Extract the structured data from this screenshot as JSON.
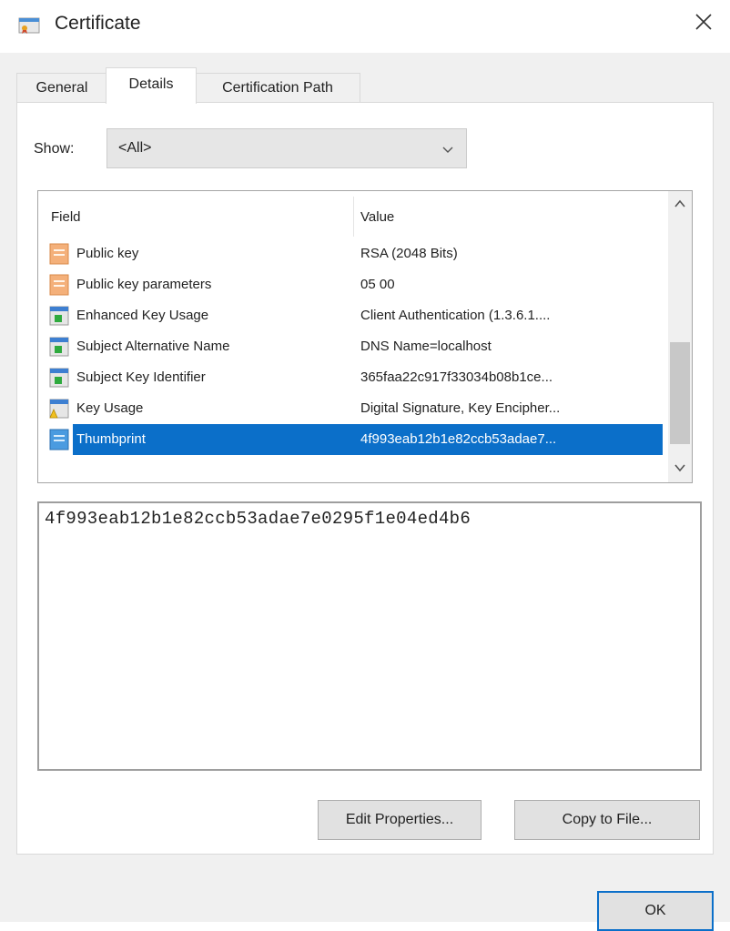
{
  "window": {
    "title": "Certificate",
    "close_label": "X"
  },
  "tabs": [
    {
      "label": "General",
      "active": false
    },
    {
      "label": "Details",
      "active": true
    },
    {
      "label": "Certification Path",
      "active": false
    }
  ],
  "show": {
    "label": "Show:",
    "selected": "<All>"
  },
  "fields": {
    "columns": [
      "Field",
      "Value"
    ],
    "rows": [
      {
        "field": "Public key",
        "value": "RSA (2048 Bits)",
        "icon": "property-icon"
      },
      {
        "field": "Public key parameters",
        "value": "05 00",
        "icon": "property-icon"
      },
      {
        "field": "Enhanced Key Usage",
        "value": "Client Authentication (1.3.6.1....",
        "icon": "extension-icon"
      },
      {
        "field": "Subject Alternative Name",
        "value": "DNS Name=localhost",
        "icon": "extension-icon"
      },
      {
        "field": "Subject Key Identifier",
        "value": "365faa22c917f33034b08b1ce...",
        "icon": "extension-icon"
      },
      {
        "field": "Key Usage",
        "value": "Digital Signature, Key Encipher...",
        "icon": "critical-extension-icon"
      },
      {
        "field": "Thumbprint",
        "value": "4f993eab12b1e82ccb53adae7...",
        "icon": "thumbprint-icon",
        "selected": true
      }
    ]
  },
  "value_box": {
    "text": "4f993eab12b1e82ccb53adae7e0295f1e04ed4b6"
  },
  "buttons": {
    "edit_properties": "Edit Properties...",
    "copy_to_file": "Copy to File...",
    "ok": "OK"
  },
  "colors": {
    "selection": "#0b6fc9",
    "dialog_bg": "#f0f0f0"
  }
}
